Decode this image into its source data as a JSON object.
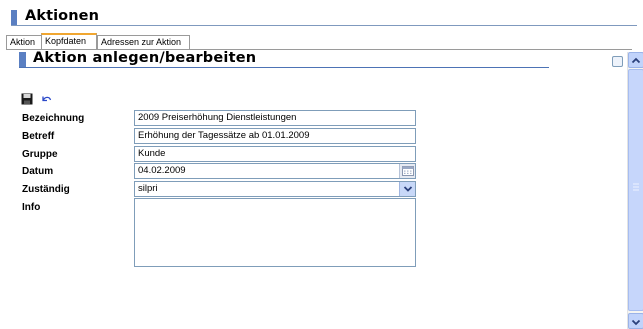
{
  "page": {
    "title": "Aktionen"
  },
  "tabs": [
    {
      "label": "Aktion",
      "active": false
    },
    {
      "label": "Kopfdaten",
      "active": true
    },
    {
      "label": "Adressen zur Aktion",
      "active": false
    }
  ],
  "section": {
    "title": "Aktion anlegen/bearbeiten"
  },
  "toolbar": {
    "save_icon": "save-icon",
    "undo_icon": "undo-icon"
  },
  "form": {
    "bezeichnung": {
      "label": "Bezeichnung",
      "value": "2009 Preiserhöhung Dienstleistungen"
    },
    "betreff": {
      "label": "Betreff",
      "value": "Erhöhung der Tagessätze ab 01.01.2009"
    },
    "gruppe": {
      "label": "Gruppe",
      "value": "Kunde"
    },
    "datum": {
      "label": "Datum",
      "value": "04.02.2009"
    },
    "zustaendig": {
      "label": "Zuständig",
      "value": "silpri"
    },
    "info": {
      "label": "Info",
      "value": ""
    }
  },
  "colors": {
    "accent": "#5a7fc2",
    "active_tab": "#f0a630",
    "field_border": "#7f9db9"
  }
}
